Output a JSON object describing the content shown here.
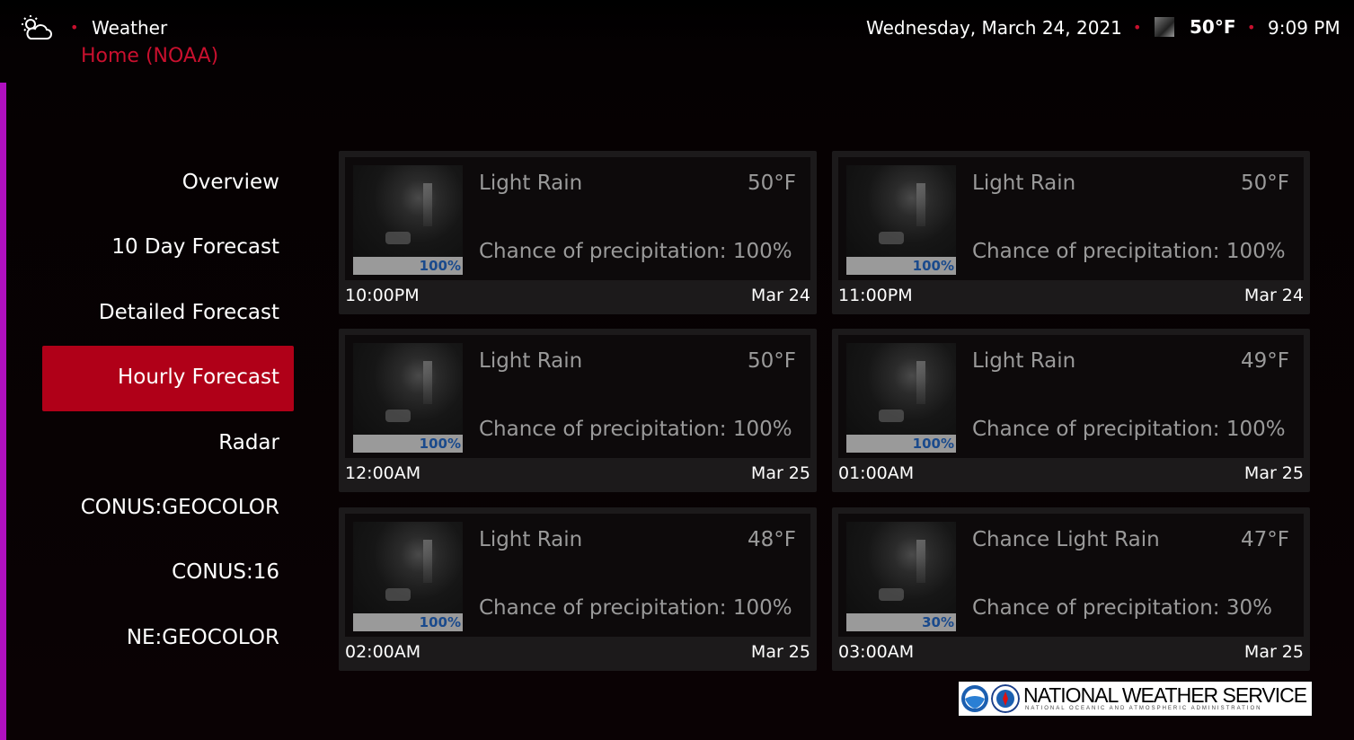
{
  "header": {
    "app_icon": "partly-cloudy-icon",
    "app_title": "Weather",
    "breadcrumb": "Home (NOAA)",
    "date": "Wednesday, March 24, 2021",
    "current_temp": "50°F",
    "time": "9:09 PM"
  },
  "menu": {
    "selected": "Hourly Forecast",
    "items": [
      {
        "label": "Overview"
      },
      {
        "label": "10 Day Forecast"
      },
      {
        "label": "Detailed Forecast"
      },
      {
        "label": "Hourly Forecast"
      },
      {
        "label": "Radar"
      },
      {
        "label": "CONUS:GEOCOLOR"
      },
      {
        "label": "CONUS:16"
      },
      {
        "label": "NE:GEOCOLOR"
      }
    ]
  },
  "forecast": [
    {
      "condition": "Light Rain",
      "temp": "50°F",
      "precip": "Chance of precipitation: 100%",
      "thumb_pct": "100%",
      "time": "10:00PM",
      "date": "Mar 24"
    },
    {
      "condition": "Light Rain",
      "temp": "50°F",
      "precip": "Chance of precipitation: 100%",
      "thumb_pct": "100%",
      "time": "11:00PM",
      "date": "Mar 24"
    },
    {
      "condition": "Light Rain",
      "temp": "50°F",
      "precip": "Chance of precipitation: 100%",
      "thumb_pct": "100%",
      "time": "12:00AM",
      "date": "Mar 25"
    },
    {
      "condition": "Light Rain",
      "temp": "49°F",
      "precip": "Chance of precipitation: 100%",
      "thumb_pct": "100%",
      "time": "01:00AM",
      "date": "Mar 25"
    },
    {
      "condition": "Light Rain",
      "temp": "48°F",
      "precip": "Chance of precipitation: 100%",
      "thumb_pct": "100%",
      "time": "02:00AM",
      "date": "Mar 25"
    },
    {
      "condition": "Chance Light Rain",
      "temp": "47°F",
      "precip": "Chance of precipitation: 30%",
      "thumb_pct": "30%",
      "time": "03:00AM",
      "date": "Mar 25"
    }
  ],
  "footer": {
    "logo_text": "NATIONAL WEATHER SERVICE",
    "logo_subtext": "NATIONAL OCEANIC AND ATMOSPHERIC ADMINISTRATION"
  },
  "colors": {
    "accent": "#c8102e",
    "selected_bg": "#b00018",
    "scrollbar": "#b010c0"
  }
}
